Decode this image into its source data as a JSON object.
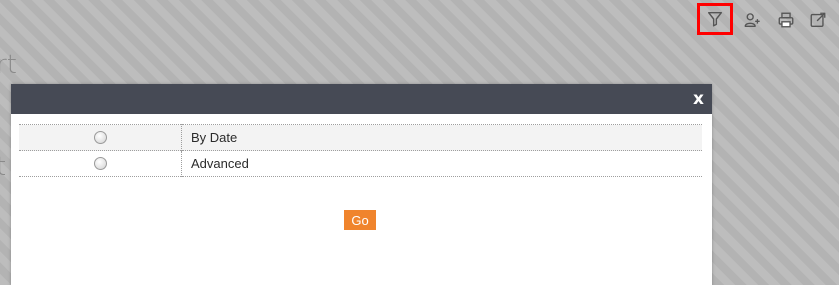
{
  "background": {
    "fragments": [
      "rt",
      "t"
    ]
  },
  "toolbar": {
    "items": [
      {
        "icon": "filter-icon",
        "highlighted": true
      },
      {
        "icon": "add-user-icon"
      },
      {
        "icon": "print-icon"
      },
      {
        "icon": "export-icon"
      }
    ],
    "highlight_color": "#ff0000"
  },
  "modal": {
    "header_color": "#464a55",
    "close_label": "x",
    "options": [
      {
        "label": "By Date",
        "selected": false
      },
      {
        "label": "Advanced",
        "selected": false
      }
    ],
    "go_label": "Go",
    "go_color": "#f0842c"
  }
}
